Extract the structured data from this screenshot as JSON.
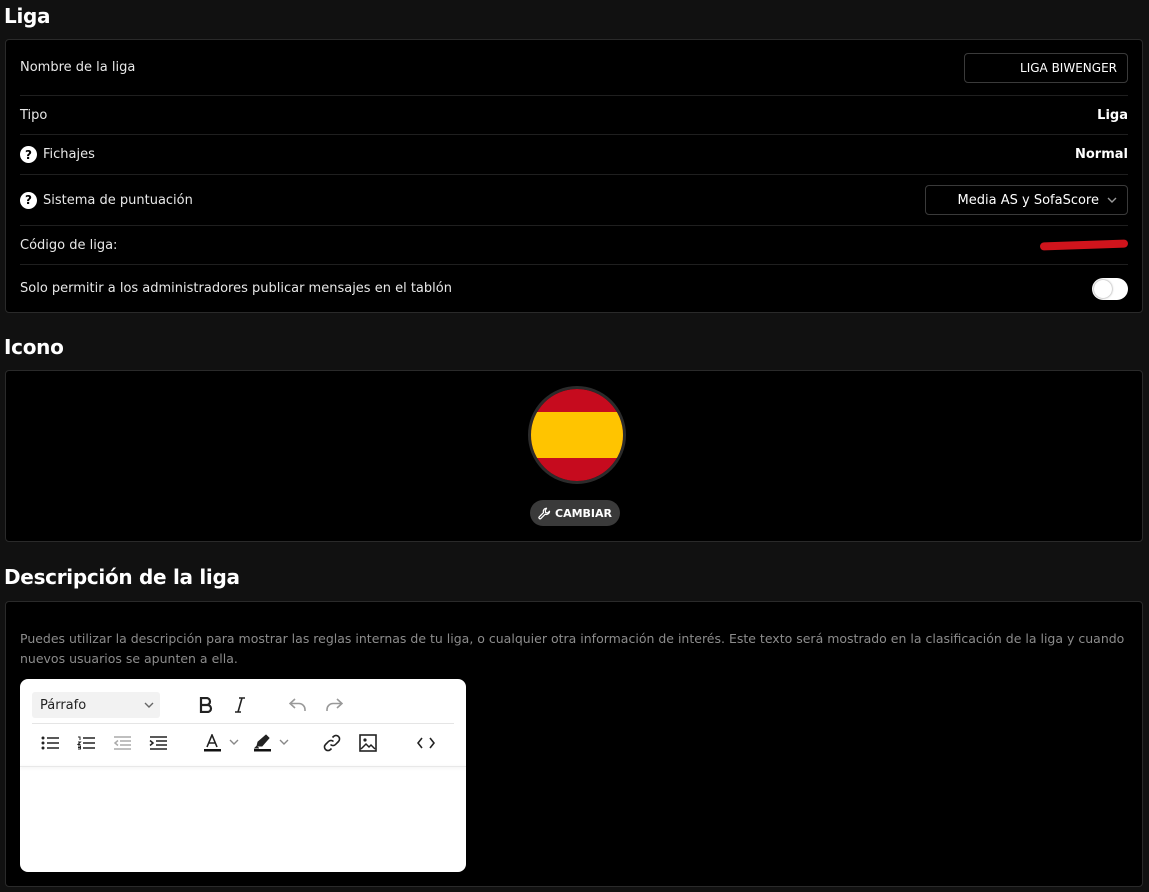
{
  "liga": {
    "title": "Liga",
    "name_label": "Nombre de la liga",
    "name_value": "LIGA BIWENGER",
    "tipo_label": "Tipo",
    "tipo_value": "Liga",
    "fichajes_label": "Fichajes",
    "fichajes_value": "Normal",
    "scoring_label": "Sistema de puntuación",
    "scoring_value": "Media AS y SofaScore",
    "code_label": "Código de liga:",
    "admin_only_label": "Solo permitir a los administradores publicar mensajes en el tablón",
    "admin_only_enabled": false
  },
  "icono": {
    "title": "Icono",
    "change_label": "CAMBIAR",
    "flag_colors": {
      "red": "#c60b1e",
      "yellow": "#ffc400"
    }
  },
  "descripcion": {
    "title": "Descripción de la liga",
    "help_text": "Puedes utilizar la descripción para mostrar las reglas internas de tu liga, o cualquier otra información de interés. Este texto será mostrado en la clasificación de la liga y cuando nuevos usuarios se apunten a ella.",
    "editor": {
      "format_value": "Párrafo",
      "icons": [
        "bold-icon",
        "italic-icon",
        "undo-icon",
        "redo-icon",
        "bullet-list-icon",
        "numbered-list-icon",
        "outdent-icon",
        "indent-icon",
        "text-color-icon",
        "highlight-icon",
        "link-icon",
        "image-icon",
        "code-icon"
      ],
      "content": ""
    }
  }
}
